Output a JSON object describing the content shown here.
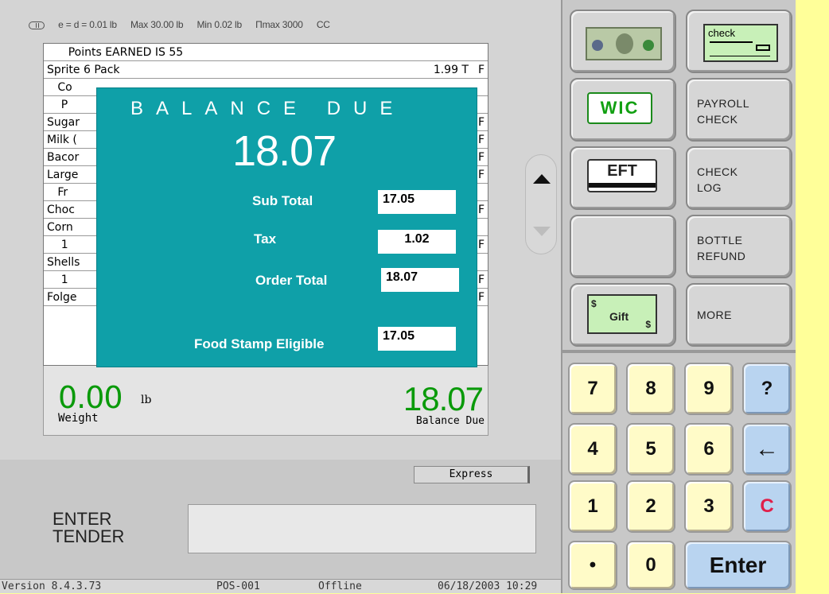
{
  "scale_info": {
    "increment": "e = d = 0.01 lb",
    "max": "Max 30.00 lb",
    "min": "Min 0.02 lb",
    "nmax": "Πmax 3000",
    "cc": "CC"
  },
  "receipt": {
    "rows": [
      {
        "text": "      Points EARNED IS 55",
        "amount": "",
        "flag": ""
      },
      {
        "text": "Sprite 6 Pack",
        "amount": "1.99  T",
        "flag": "F"
      },
      {
        "text": "   Co",
        "amount": "",
        "flag": ""
      },
      {
        "text": "    P",
        "amount": "",
        "flag": ""
      },
      {
        "text": "Sugar",
        "amount": "",
        "flag": "F"
      },
      {
        "text": "Milk (",
        "amount": "",
        "flag": "F"
      },
      {
        "text": "Bacor",
        "amount": "",
        "flag": "F"
      },
      {
        "text": "Large",
        "amount": "",
        "flag": "F"
      },
      {
        "text": "   Fr",
        "amount": "",
        "flag": ""
      },
      {
        "text": "Choc",
        "amount": "",
        "flag": "F"
      },
      {
        "text": "Corn",
        "amount": "",
        "flag": ""
      },
      {
        "text": "    1",
        "amount": "",
        "flag": "F"
      },
      {
        "text": "Shells",
        "amount": "",
        "flag": ""
      },
      {
        "text": "    1",
        "amount": "",
        "flag": "F"
      },
      {
        "text": "Folge",
        "amount": "",
        "flag": "F"
      }
    ]
  },
  "weight": {
    "value": "0.00",
    "unit": "lb",
    "label": "Weight"
  },
  "balance": {
    "value": "18.07",
    "label": "Balance Due"
  },
  "overlay": {
    "title": "BALANCE DUE",
    "amount": "18.07",
    "sub_total_label": "Sub Total",
    "sub_total": "17.05",
    "tax_label": "Tax",
    "tax": "1.02",
    "order_total_label": "Order Total",
    "order_total": "18.07",
    "food_stamp_label": "Food Stamp Eligible",
    "food_stamp": "17.05"
  },
  "express_label": "Express",
  "tender": {
    "label_line1": "ENTER",
    "label_line2": "TENDER",
    "value": ""
  },
  "status": {
    "version": "Version  8.4.3.73",
    "terminal": "POS-001",
    "state": "Offline",
    "datetime": "06/18/2003 10:29"
  },
  "buttons": {
    "cash_icon": "dollar-bill-icon",
    "check_icon": "check-icon",
    "check_text": "check",
    "wic": "WIC",
    "payroll_check_1": "PAYROLL",
    "payroll_check_2": "CHECK",
    "eft": "EFT",
    "check_log_1": "CHECK",
    "check_log_2": "LOG",
    "bottle_refund_1": "BOTTLE",
    "bottle_refund_2": "REFUND",
    "gift_text": "Gift",
    "gift_symbol": "$",
    "more": "MORE"
  },
  "keypad": {
    "k7": "7",
    "k8": "8",
    "k9": "9",
    "help": "?",
    "k4": "4",
    "k5": "5",
    "k6": "6",
    "back": "←",
    "k1": "1",
    "k2": "2",
    "k3": "3",
    "clear": "C",
    "dot": "•",
    "k0": "0",
    "enter": "Enter"
  },
  "colors": {
    "overlay_bg": "#0fa0a8",
    "amount_green": "#0a9a0a",
    "key_yellow": "#fffbc8",
    "key_blue": "#b9d4f0",
    "clear_red": "#e0204a"
  }
}
